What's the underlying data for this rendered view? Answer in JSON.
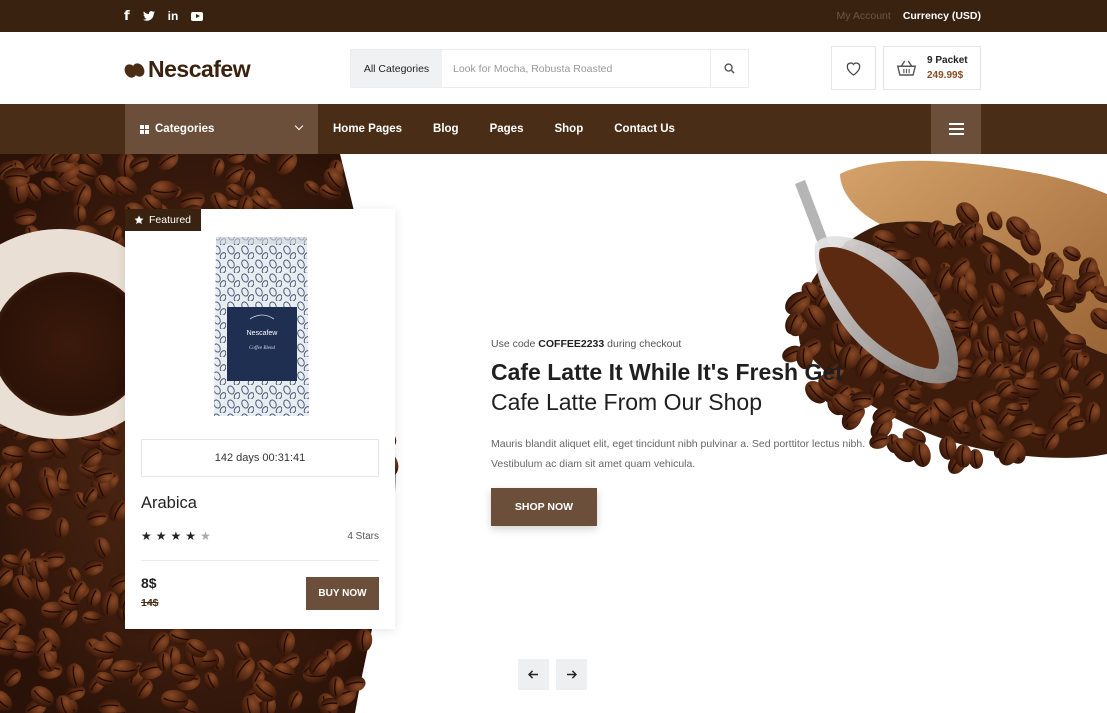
{
  "topbar": {
    "social": [
      {
        "icon": "facebook-icon",
        "glyph": "f"
      },
      {
        "icon": "twitter-icon",
        "glyph": "𝕥"
      },
      {
        "icon": "linkedin-icon",
        "glyph": "in"
      },
      {
        "icon": "youtube-icon",
        "glyph": ""
      }
    ],
    "account": "My Account",
    "currency": "Currency (USD)"
  },
  "header": {
    "logo_text": "Nescafew",
    "search": {
      "category": "All Categories",
      "placeholder": "Look for Mocha, Robusta Roasted"
    },
    "cart": {
      "count": "9 Packet",
      "total": "249.99$"
    }
  },
  "nav": {
    "categories_label": "Categories",
    "items": [
      "Home Pages",
      "Blog",
      "Pages",
      "Shop",
      "Contact Us"
    ]
  },
  "card": {
    "badge": "Featured",
    "pack_brand": "Nescafew",
    "pack_sub": "Coffee Blend",
    "timer": "142 days 00:31:41",
    "name": "Arabica",
    "rating": 4,
    "rating_max": 5,
    "rating_text": "4 Stars",
    "price": "8$",
    "old_price": "14$",
    "buy_label": "BUY NOW"
  },
  "hero": {
    "promo_prefix": "Use code ",
    "promo_code": "COFFEE2233",
    "promo_suffix": " during checkout",
    "title": "Cafe Latte It While It's Fresh Get",
    "subtitle": "Cafe Latte From Our Shop",
    "description": "Mauris blandit aliquet elit, eget tincidunt nibh pulvinar a. Sed porttitor lectus nibh. Vestibulum ac diam sit amet quam vehicula.",
    "cta": "SHOP NOW"
  },
  "colors": {
    "topbar": "#3a2210",
    "navbar": "#4a2d17",
    "accent": "#6b4f3a"
  }
}
